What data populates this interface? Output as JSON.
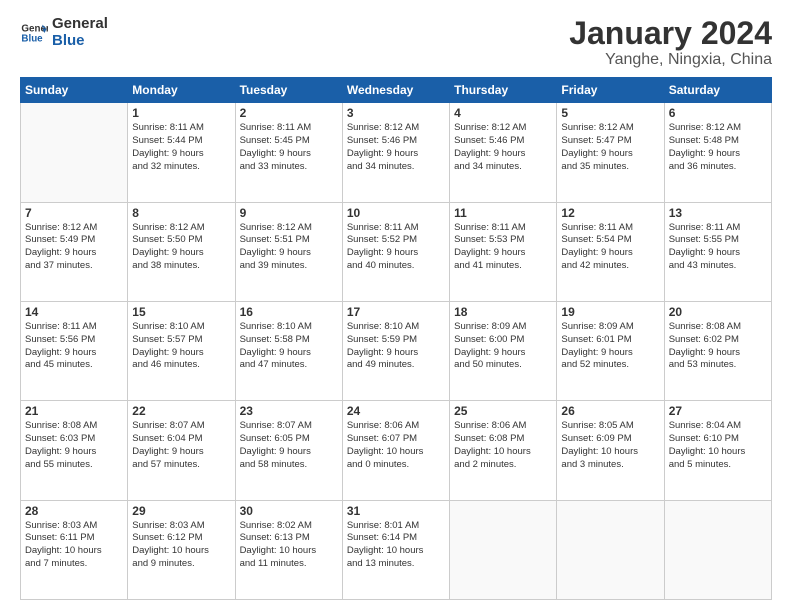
{
  "header": {
    "logo_line1": "General",
    "logo_line2": "Blue",
    "title": "January 2024",
    "subtitle": "Yanghe, Ningxia, China"
  },
  "days_of_week": [
    "Sunday",
    "Monday",
    "Tuesday",
    "Wednesday",
    "Thursday",
    "Friday",
    "Saturday"
  ],
  "weeks": [
    [
      {
        "day": "",
        "info": ""
      },
      {
        "day": "1",
        "info": "Sunrise: 8:11 AM\nSunset: 5:44 PM\nDaylight: 9 hours\nand 32 minutes."
      },
      {
        "day": "2",
        "info": "Sunrise: 8:11 AM\nSunset: 5:45 PM\nDaylight: 9 hours\nand 33 minutes."
      },
      {
        "day": "3",
        "info": "Sunrise: 8:12 AM\nSunset: 5:46 PM\nDaylight: 9 hours\nand 34 minutes."
      },
      {
        "day": "4",
        "info": "Sunrise: 8:12 AM\nSunset: 5:46 PM\nDaylight: 9 hours\nand 34 minutes."
      },
      {
        "day": "5",
        "info": "Sunrise: 8:12 AM\nSunset: 5:47 PM\nDaylight: 9 hours\nand 35 minutes."
      },
      {
        "day": "6",
        "info": "Sunrise: 8:12 AM\nSunset: 5:48 PM\nDaylight: 9 hours\nand 36 minutes."
      }
    ],
    [
      {
        "day": "7",
        "info": ""
      },
      {
        "day": "8",
        "info": "Sunrise: 8:12 AM\nSunset: 5:50 PM\nDaylight: 9 hours\nand 38 minutes."
      },
      {
        "day": "9",
        "info": "Sunrise: 8:12 AM\nSunset: 5:51 PM\nDaylight: 9 hours\nand 39 minutes."
      },
      {
        "day": "10",
        "info": "Sunrise: 8:11 AM\nSunset: 5:52 PM\nDaylight: 9 hours\nand 40 minutes."
      },
      {
        "day": "11",
        "info": "Sunrise: 8:11 AM\nSunset: 5:53 PM\nDaylight: 9 hours\nand 41 minutes."
      },
      {
        "day": "12",
        "info": "Sunrise: 8:11 AM\nSunset: 5:54 PM\nDaylight: 9 hours\nand 42 minutes."
      },
      {
        "day": "13",
        "info": "Sunrise: 8:11 AM\nSunset: 5:55 PM\nDaylight: 9 hours\nand 43 minutes."
      }
    ],
    [
      {
        "day": "14",
        "info": "Sunrise: 8:11 AM\nSunset: 5:56 PM\nDaylight: 9 hours\nand 45 minutes."
      },
      {
        "day": "15",
        "info": "Sunrise: 8:10 AM\nSunset: 5:57 PM\nDaylight: 9 hours\nand 46 minutes."
      },
      {
        "day": "16",
        "info": "Sunrise: 8:10 AM\nSunset: 5:58 PM\nDaylight: 9 hours\nand 47 minutes."
      },
      {
        "day": "17",
        "info": "Sunrise: 8:10 AM\nSunset: 5:59 PM\nDaylight: 9 hours\nand 49 minutes."
      },
      {
        "day": "18",
        "info": "Sunrise: 8:09 AM\nSunset: 6:00 PM\nDaylight: 9 hours\nand 50 minutes."
      },
      {
        "day": "19",
        "info": "Sunrise: 8:09 AM\nSunset: 6:01 PM\nDaylight: 9 hours\nand 52 minutes."
      },
      {
        "day": "20",
        "info": "Sunrise: 8:08 AM\nSunset: 6:02 PM\nDaylight: 9 hours\nand 53 minutes."
      }
    ],
    [
      {
        "day": "21",
        "info": "Sunrise: 8:08 AM\nSunset: 6:03 PM\nDaylight: 9 hours\nand 55 minutes."
      },
      {
        "day": "22",
        "info": "Sunrise: 8:07 AM\nSunset: 6:04 PM\nDaylight: 9 hours\nand 57 minutes."
      },
      {
        "day": "23",
        "info": "Sunrise: 8:07 AM\nSunset: 6:05 PM\nDaylight: 9 hours\nand 58 minutes."
      },
      {
        "day": "24",
        "info": "Sunrise: 8:06 AM\nSunset: 6:07 PM\nDaylight: 10 hours\nand 0 minutes."
      },
      {
        "day": "25",
        "info": "Sunrise: 8:06 AM\nSunset: 6:08 PM\nDaylight: 10 hours\nand 2 minutes."
      },
      {
        "day": "26",
        "info": "Sunrise: 8:05 AM\nSunset: 6:09 PM\nDaylight: 10 hours\nand 3 minutes."
      },
      {
        "day": "27",
        "info": "Sunrise: 8:04 AM\nSunset: 6:10 PM\nDaylight: 10 hours\nand 5 minutes."
      }
    ],
    [
      {
        "day": "28",
        "info": "Sunrise: 8:03 AM\nSunset: 6:11 PM\nDaylight: 10 hours\nand 7 minutes."
      },
      {
        "day": "29",
        "info": "Sunrise: 8:03 AM\nSunset: 6:12 PM\nDaylight: 10 hours\nand 9 minutes."
      },
      {
        "day": "30",
        "info": "Sunrise: 8:02 AM\nSunset: 6:13 PM\nDaylight: 10 hours\nand 11 minutes."
      },
      {
        "day": "31",
        "info": "Sunrise: 8:01 AM\nSunset: 6:14 PM\nDaylight: 10 hours\nand 13 minutes."
      },
      {
        "day": "",
        "info": ""
      },
      {
        "day": "",
        "info": ""
      },
      {
        "day": "",
        "info": ""
      }
    ]
  ],
  "week7_sunday": {
    "info": "Sunrise: 8:12 AM\nSunset: 5:49 PM\nDaylight: 9 hours\nand 37 minutes."
  }
}
